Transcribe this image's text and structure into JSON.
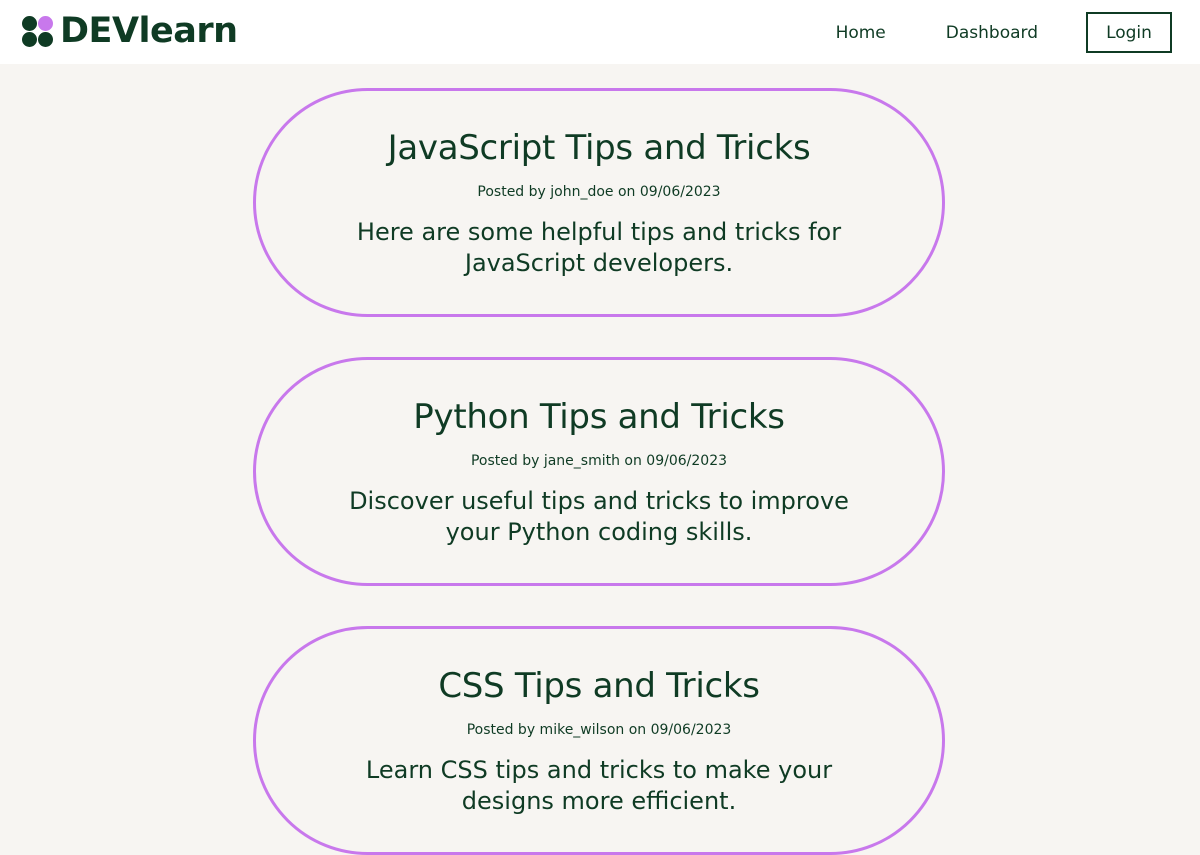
{
  "colors": {
    "brand_green": "#0f3b24",
    "accent_purple": "#c878ec",
    "page_bg": "#f7f5f2",
    "topbar_bg": "#ffffff"
  },
  "header": {
    "brand": "DEVlearn",
    "nav": {
      "home": "Home",
      "dashboard": "Dashboard",
      "login": "Login"
    }
  },
  "posts": [
    {
      "title": "JavaScript Tips and Tricks",
      "meta": "Posted by john_doe on 09/06/2023",
      "body": "Here are some helpful tips and tricks for JavaScript developers."
    },
    {
      "title": "Python Tips and Tricks",
      "meta": "Posted by jane_smith on 09/06/2023",
      "body": "Discover useful tips and tricks to improve your Python coding skills."
    },
    {
      "title": "CSS Tips and Tricks",
      "meta": "Posted by mike_wilson on 09/06/2023",
      "body": "Learn CSS tips and tricks to make your designs more efficient."
    }
  ]
}
